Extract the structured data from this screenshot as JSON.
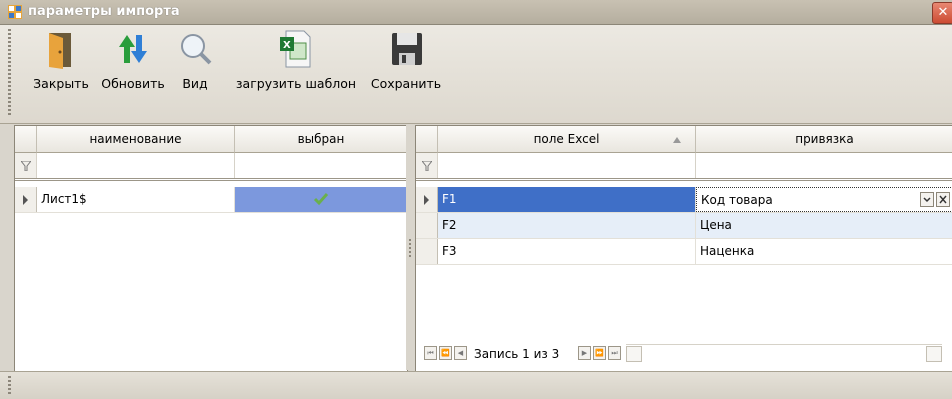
{
  "window": {
    "title": "параметры импорта",
    "close_glyph": "✕"
  },
  "toolbar": {
    "items": [
      {
        "label": "Закрыть",
        "icon": "door-exit-icon"
      },
      {
        "label": "Обновить",
        "icon": "refresh-arrows-icon"
      },
      {
        "label": "Вид",
        "icon": "magnifier-icon"
      },
      {
        "label": "загрузить шаблон",
        "icon": "excel-file-icon"
      },
      {
        "label": "Сохранить",
        "icon": "floppy-disk-icon"
      }
    ]
  },
  "left_grid": {
    "columns": [
      "наименование",
      "выбран"
    ],
    "rows": [
      {
        "name": "Лист1$",
        "selected": true
      }
    ]
  },
  "right_grid": {
    "columns": [
      "поле Excel",
      "привязка"
    ],
    "rows": [
      {
        "field": "F1",
        "binding": "Код товара"
      },
      {
        "field": "F2",
        "binding": "Цена"
      },
      {
        "field": "F3",
        "binding": "Наценка"
      }
    ],
    "navigator": {
      "record_text": "Запись 1 из 3"
    }
  },
  "colors": {
    "selection_blue": "#3f6fc7",
    "checked_cell": "#7c98dd",
    "check_green": "#6ab04c"
  }
}
